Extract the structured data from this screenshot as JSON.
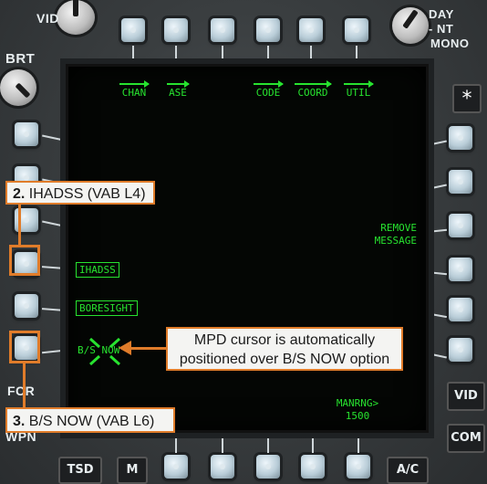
{
  "bezel": {
    "vid_knob": "VID",
    "day": "DAY",
    "nt": "NT",
    "mono": "MONO",
    "brt": "BRT",
    "star": "*",
    "fcr": "FCR",
    "wpn": "WPN",
    "vid_button": "VID",
    "com_button": "COM",
    "tsd_button": "TSD",
    "m_button": "M",
    "ac_button": "A/C"
  },
  "screen": {
    "top_labels": [
      "CHAN",
      "ASE",
      "CODE",
      "COORD",
      "UTIL"
    ],
    "remove_message": [
      "REMOVE",
      "MESSAGE"
    ],
    "ihadss": "IHADSS",
    "boresight": "BORESIGHT",
    "bs_now": "B/S NOW",
    "manrng_label": "MANRNG>",
    "manrng_value": "1500"
  },
  "callouts": {
    "ihadss_step": "2.",
    "ihadss_text": " IHADSS (VAB L4)",
    "bsnow_step": "3.",
    "bsnow_text": " B/S NOW (VAB L6)",
    "cursor_line1": "MPD cursor is automatically",
    "cursor_line2": "positioned over B/S NOW option"
  },
  "colors": {
    "symbology": "#27e32f",
    "callout_border": "#e07c2a"
  }
}
